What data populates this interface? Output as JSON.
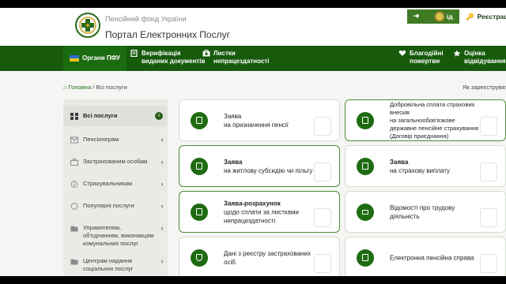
{
  "header": {
    "org_name": "Пенсійний фонд України",
    "portal_title": "Портал Електронних Послуг",
    "login_label": "ід",
    "register_label": "Реєстрація"
  },
  "nav": {
    "pfu": "Органи ПФУ",
    "verification_line1": "Верифікація",
    "verification_line2": "виданих документів",
    "sick_line1": "Листки",
    "sick_line2": "непрацездатності",
    "charity_line1": "Благодійні",
    "charity_line2": "пожертви",
    "rate_line1": "Оцінка",
    "rate_line2": "відвідування ПФУ"
  },
  "breadcrumb": {
    "home": "Головна",
    "current": "/ Всі послуги",
    "not_registered": "Як зареєструвати"
  },
  "sidebar": {
    "items": [
      {
        "label": "Всі послуги",
        "icon": "grid-icon"
      },
      {
        "label": "Пенсіонерам",
        "icon": "envelope-icon"
      },
      {
        "label": "Застрахованим особам",
        "icon": "briefcase-icon"
      },
      {
        "label": "Страхувальникам",
        "icon": "info-icon"
      },
      {
        "label": "Популярні послуги",
        "icon": "star-icon"
      },
      {
        "label": "Управителям, об'єднанням, виконавцям комунальних послуг",
        "icon": "folder-icon"
      },
      {
        "label": "Центрам надання соціальних послуг",
        "icon": "folder-icon"
      }
    ]
  },
  "cards": [
    {
      "title": "Заява",
      "subtitle": "на призначення пенсії"
    },
    {
      "title": "Добровільна сплата страхових внесків",
      "subtitle": "на загальнообов'язкове державне пенсійне страхування (Договір приєднання)"
    },
    {
      "title": "Заява",
      "subtitle": "на житлову субсидію чи пільгу"
    },
    {
      "title": "Заява",
      "subtitle": "на страхову виплату"
    },
    {
      "title": "Заява-розрахунок",
      "subtitle": "щодо сплати за листками непрацездатності"
    },
    {
      "title": "",
      "subtitle": "Відомості про трудову діяльність"
    },
    {
      "title": "",
      "subtitle": "Дані з реєстру застрахованих осіб"
    },
    {
      "title": "",
      "subtitle": "Електронна пенсійна справа"
    }
  ],
  "colors": {
    "primary_green": "#175a0c",
    "accent_green": "#1e6b12",
    "background": "#f5f6f4"
  }
}
